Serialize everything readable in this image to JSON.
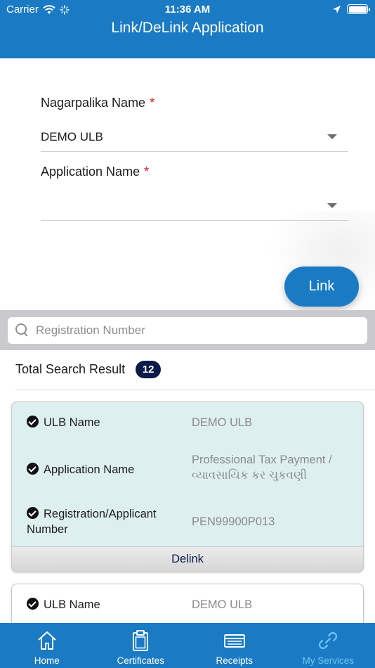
{
  "status_bar": {
    "carrier": "Carrier",
    "time": "11:36 AM"
  },
  "header": {
    "title": "Link/DeLink Application"
  },
  "form": {
    "nagarpalika": {
      "label": "Nagarpalika Name",
      "required_mark": "*",
      "value": "DEMO ULB"
    },
    "application": {
      "label": "Application Name",
      "required_mark": "*",
      "value": ""
    },
    "link_button": "Link"
  },
  "search": {
    "placeholder": "Registration Number"
  },
  "results": {
    "label": "Total Search Result",
    "count": "12",
    "cards": [
      {
        "ulb_label": "ULB Name",
        "ulb_value": "DEMO ULB",
        "app_label": "Application Name",
        "app_value": "Professional Tax Payment / વ્યાવસાયિક કર ચુકવણી",
        "reg_label": "Registration/Applicant Number",
        "reg_value": "PEN99900P013",
        "delink_label": "Delink"
      },
      {
        "ulb_label": "ULB Name",
        "ulb_value": "DEMO ULB"
      }
    ]
  },
  "tabbar": {
    "tabs": [
      {
        "label": "Home",
        "icon": "home-icon"
      },
      {
        "label": "Certificates",
        "icon": "clipboard-icon"
      },
      {
        "label": "Receipts",
        "icon": "receipt-icon"
      },
      {
        "label": "My Services",
        "icon": "link-icon",
        "active": true
      }
    ]
  },
  "colors": {
    "primary": "#1a7bc4",
    "badge": "#0d1b4a",
    "active_tab": "#6fc6f4",
    "card_bg": "#deeff0",
    "required": "#e01b24"
  }
}
